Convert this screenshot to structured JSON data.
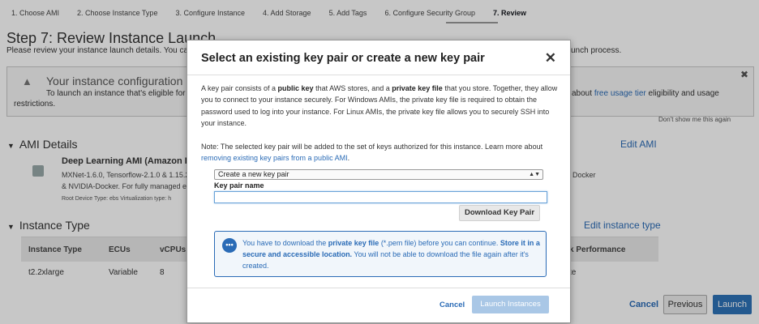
{
  "wizard": {
    "steps": [
      "1. Choose AMI",
      "2. Choose Instance Type",
      "3. Configure Instance",
      "4. Add Storage",
      "5. Add Tags",
      "6. Configure Security Group",
      "7. Review"
    ],
    "active_index": 6
  },
  "page": {
    "title": "Step 7: Review Instance Launch",
    "subtitle": "Please review your instance launch details. You can g",
    "subtitle_tail": "unch process."
  },
  "warning": {
    "title": "Your instance configuration is no",
    "line1": "To launch an instance that's eligible for th",
    "line2": "restrictions.",
    "tail_pre": "about",
    "tail_link": "free usage tier",
    "tail_post": "eligibility and usage",
    "dont_show": "Don't show me this again"
  },
  "ami": {
    "section": "AMI Details",
    "edit": "Edit AMI",
    "name": "Deep Learning AMI (Amazon Lin",
    "line1": "MXNet-1.6.0, Tensorflow-2.1.0 & 1.15.2",
    "line2": "& NVIDIA-Docker. For fully managed ex",
    "root": "Root Device Type: ebs     Virtualization type: h",
    "tail1": "Docker"
  },
  "instance_type": {
    "section": "Instance Type",
    "edit": "Edit instance type",
    "headers": [
      "Instance Type",
      "ECUs",
      "vCPUs",
      "k Performance"
    ],
    "row": [
      "t2.2xlarge",
      "Variable",
      "8",
      "te"
    ]
  },
  "footer": {
    "cancel": "Cancel",
    "previous": "Previous",
    "launch": "Launch"
  },
  "modal": {
    "title": "Select an existing key pair or create a new key pair",
    "para1_a": "A key pair consists of a ",
    "para1_b": "public key",
    "para1_c": " that AWS stores, and a ",
    "para1_d": "private key file",
    "para1_e": " that you store. Together, they allow you to connect to your instance securely. For Windows AMIs, the private key file is required to obtain the password used to log into your instance. For Linux AMIs, the private key file allows you to securely SSH into your instance.",
    "note_a": "Note: The selected key pair will be added to the set of keys authorized for this instance. Learn more about ",
    "note_link": "removing existing key pairs from a public AMI",
    "note_b": ".",
    "select_value": "Create a new key pair",
    "key_label": "Key pair name",
    "key_value": "",
    "download": "Download Key Pair",
    "info_a": "You have to download the ",
    "info_b": "private key file",
    "info_c": " (*.pem file) before you can continue. ",
    "info_d": "Store it in a secure and accessible location.",
    "info_e": " You will not be able to download the file again after it's created.",
    "cancel": "Cancel",
    "launch": "Launch Instances"
  }
}
